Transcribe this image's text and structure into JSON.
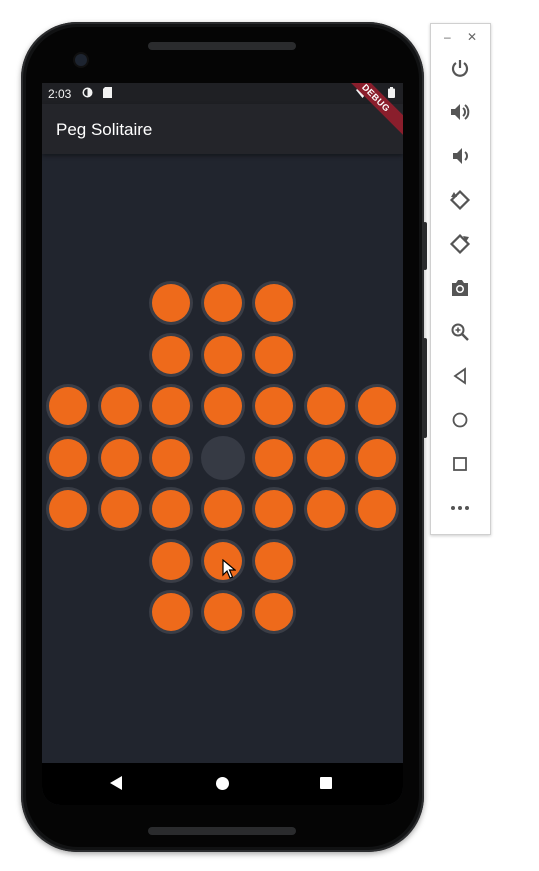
{
  "status_bar": {
    "time": "2:03"
  },
  "app_bar": {
    "title": "Peg Solitaire"
  },
  "debug_banner": "DEBUG",
  "board": {
    "rows": [
      [
        null,
        null,
        1,
        1,
        1,
        null,
        null
      ],
      [
        null,
        null,
        1,
        1,
        1,
        null,
        null
      ],
      [
        1,
        1,
        1,
        1,
        1,
        1,
        1
      ],
      [
        1,
        1,
        1,
        0,
        1,
        1,
        1
      ],
      [
        1,
        1,
        1,
        1,
        1,
        1,
        1
      ],
      [
        null,
        null,
        1,
        1,
        1,
        null,
        null
      ],
      [
        null,
        null,
        1,
        1,
        1,
        null,
        null
      ]
    ],
    "peg_color": "#ee6a1b",
    "empty_color": "#363a44",
    "background_color": "#21252e"
  },
  "nav_bar": {
    "back": "back-icon",
    "home": "home-icon",
    "recents": "recents-icon"
  },
  "emulator_toolbar": {
    "window_controls": [
      "minimize-icon",
      "close-icon"
    ],
    "minimize_glyph": "–",
    "close_glyph": "✕",
    "buttons": [
      "power-icon",
      "volume-up-icon",
      "volume-down-icon",
      "rotate-left-icon",
      "rotate-right-icon",
      "camera-icon",
      "zoom-icon",
      "back-triangle-icon",
      "home-circle-icon",
      "overview-square-icon",
      "more-icon"
    ]
  }
}
